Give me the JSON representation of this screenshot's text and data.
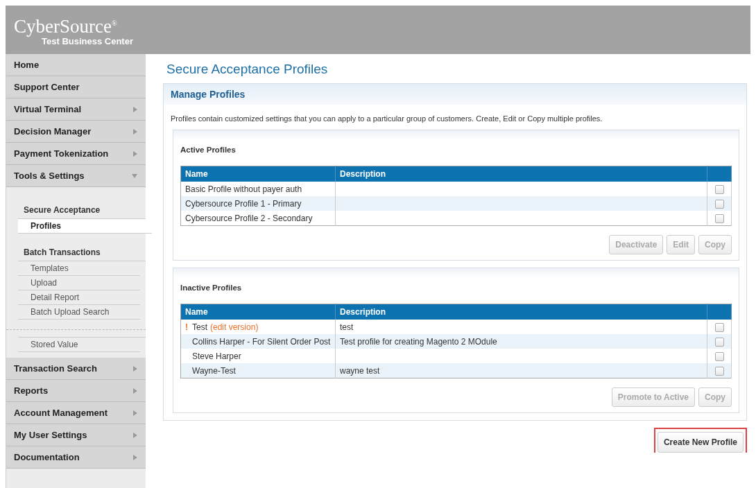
{
  "logo": {
    "brand": "CyberSource",
    "mark": "®",
    "subtitle": "Test Business Center"
  },
  "nav_top": [
    {
      "label": "Home",
      "kind": "plain"
    },
    {
      "label": "Support Center",
      "kind": "plain"
    },
    {
      "label": "Virtual Terminal",
      "kind": "submenu",
      "expanded": false
    },
    {
      "label": "Decision Manager",
      "kind": "submenu",
      "expanded": false
    },
    {
      "label": "Payment Tokenization",
      "kind": "submenu",
      "expanded": false
    },
    {
      "label": "Tools & Settings",
      "kind": "submenu",
      "expanded": true
    }
  ],
  "subnav": [
    {
      "title": "Secure Acceptance",
      "items": [
        {
          "label": "Profiles",
          "selected": true
        }
      ]
    },
    {
      "title": "Batch Transactions",
      "items": [
        {
          "label": "Templates",
          "selected": false
        },
        {
          "label": "Upload",
          "selected": false
        },
        {
          "label": "Detail Report",
          "selected": false
        },
        {
          "label": "Batch Upload Search",
          "selected": false
        }
      ]
    },
    {
      "items": [
        {
          "label": "Stored Value",
          "selected": false
        }
      ]
    }
  ],
  "nav_bottom": [
    {
      "label": "Transaction Search",
      "kind": "submenu",
      "expanded": false
    },
    {
      "label": "Reports",
      "kind": "submenu",
      "expanded": false
    },
    {
      "label": "Account Management",
      "kind": "submenu",
      "expanded": false
    },
    {
      "label": "My User Settings",
      "kind": "submenu",
      "expanded": false
    },
    {
      "label": "Documentation",
      "kind": "submenu",
      "expanded": false
    }
  ],
  "page_title": "Secure Acceptance Profiles",
  "panel": {
    "title": "Manage Profiles",
    "intro": "Profiles contain customized settings that you can apply to a particular group of customers. Create, Edit or Copy multiple profiles.",
    "sections": [
      {
        "title": "Active Profiles",
        "columns": [
          "Name",
          "Description"
        ],
        "rows": [
          {
            "name": "Basic Profile without payer auth",
            "checked": false
          },
          {
            "name": "Cybersource Profile 1 - Primary",
            "checked": false
          },
          {
            "name": "Cybersource Profile 2 - Secondary",
            "checked": false
          }
        ],
        "buttons": [
          {
            "label": "Deactivate",
            "disabled": true
          },
          {
            "label": "Edit",
            "disabled": true
          },
          {
            "label": "Copy",
            "disabled": true
          }
        ]
      },
      {
        "title": "Inactive Profiles",
        "columns": [
          "Name",
          "Description"
        ],
        "rows": [
          {
            "flag": "!",
            "name": "Test",
            "note": "(edit version)",
            "description": "test",
            "checked": false
          },
          {
            "name": "Collins Harper - For Silent Order Post",
            "description": "Test profile for creating Magento 2 MOdule",
            "checked": false
          },
          {
            "name": "Steve Harper",
            "checked": false
          },
          {
            "name": "Wayne-Test",
            "description": "wayne test",
            "checked": false
          }
        ],
        "buttons": [
          {
            "label": "Promote to Active",
            "disabled": true
          },
          {
            "label": "Copy",
            "disabled": true
          }
        ]
      }
    ]
  },
  "create_button": {
    "label": "Create New Profile",
    "highlighted": true
  }
}
